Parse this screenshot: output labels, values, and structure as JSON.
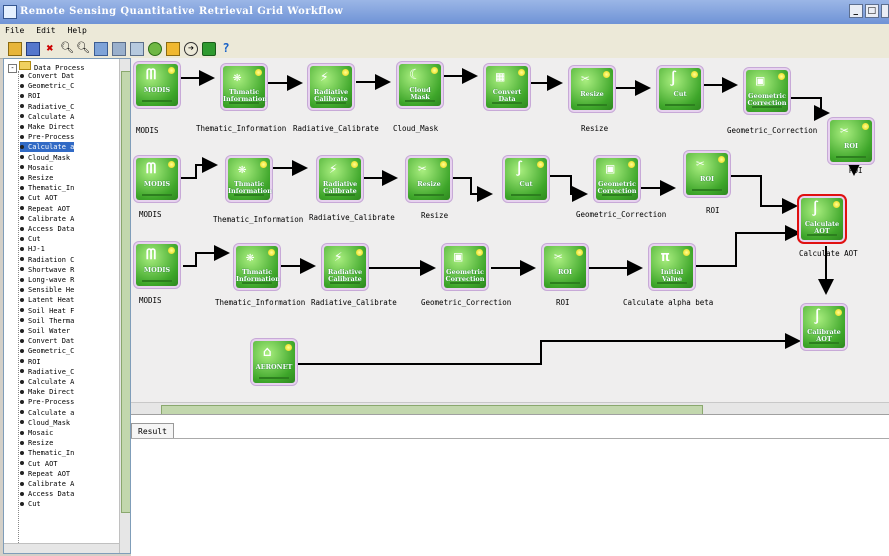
{
  "window": {
    "title": "Remote Sensing Quantitative Retrieval Grid Workflow"
  },
  "menu": {
    "file": "File",
    "edit": "Edit",
    "help": "Help"
  },
  "tree": {
    "root": "Data Process",
    "items": [
      "Convert Dat",
      "Geometric_C",
      "ROI",
      "Radiative_C",
      "Calculate A",
      "Make Direct",
      "Pre-Process",
      "Calculate a",
      "Cloud_Mask",
      "Mosaic",
      "Resize",
      "Thematic_In",
      "Cut AOT",
      "Repeat AOT",
      "Calibrate A",
      "Access Data",
      "Cut",
      "HJ-1",
      "Radiation C",
      "Shortwave R",
      "Long-wave R",
      "Sensible He",
      "Latent Heat",
      "Soil Heat F",
      "Soil Therma",
      "Soil Water",
      "Convert Dat",
      "Geometric_C",
      "ROI",
      "Radiative_C",
      "Calculate A",
      "Make Direct",
      "Pre-Process",
      "Calculate a",
      "Cloud_Mask",
      "Mosaic",
      "Resize",
      "Thematic_In",
      "Cut AOT",
      "Repeat AOT",
      "Calibrate A",
      "Access Data",
      "Cut"
    ]
  },
  "nodes": {
    "r1": [
      {
        "label": "MODIS",
        "caption": "MODIS"
      },
      {
        "label": "Thmatic Information",
        "caption": "Thematic_Information"
      },
      {
        "label": "Radiative Calibrate",
        "caption": "Radiative_Calibrate"
      },
      {
        "label": "Cloud Mask",
        "caption": "Cloud_Mask"
      },
      {
        "label": "Convert Data",
        "caption": ""
      },
      {
        "label": "Resize",
        "caption": "Resize"
      },
      {
        "label": "Cut",
        "caption": ""
      },
      {
        "label": "Geometric Correction",
        "caption": "Geometric_Correction"
      },
      {
        "label": "ROI",
        "caption": "ROI"
      }
    ],
    "r2": [
      {
        "label": "MODIS",
        "caption": "MODIS"
      },
      {
        "label": "Thmatic Information",
        "caption": "Thematic_Information"
      },
      {
        "label": "Radiative Calibrate",
        "caption": "Radiative_Calibrate"
      },
      {
        "label": "Resize",
        "caption": "Resize"
      },
      {
        "label": "Cut",
        "caption": ""
      },
      {
        "label": "Geometric Correction",
        "caption": "Geometric_Correction"
      },
      {
        "label": "ROI",
        "caption": "ROI"
      },
      {
        "label": "Calculate AOT",
        "caption": "Calculate AOT"
      }
    ],
    "r3": [
      {
        "label": "MODIS",
        "caption": "MODIS"
      },
      {
        "label": "Thmatic Information",
        "caption": "Thematic_Information"
      },
      {
        "label": "Radiative Calibrate",
        "caption": "Radiative_Calibrate"
      },
      {
        "label": "Geometric Correction",
        "caption": "Geometric_Correction"
      },
      {
        "label": "ROI",
        "caption": "ROI"
      },
      {
        "label": "Initial Value",
        "caption": "Calculate alpha beta"
      },
      {
        "label": "Calibrate AOT",
        "caption": ""
      },
      {
        "label": "AERONET",
        "caption": ""
      }
    ]
  },
  "result_tab": "Result"
}
